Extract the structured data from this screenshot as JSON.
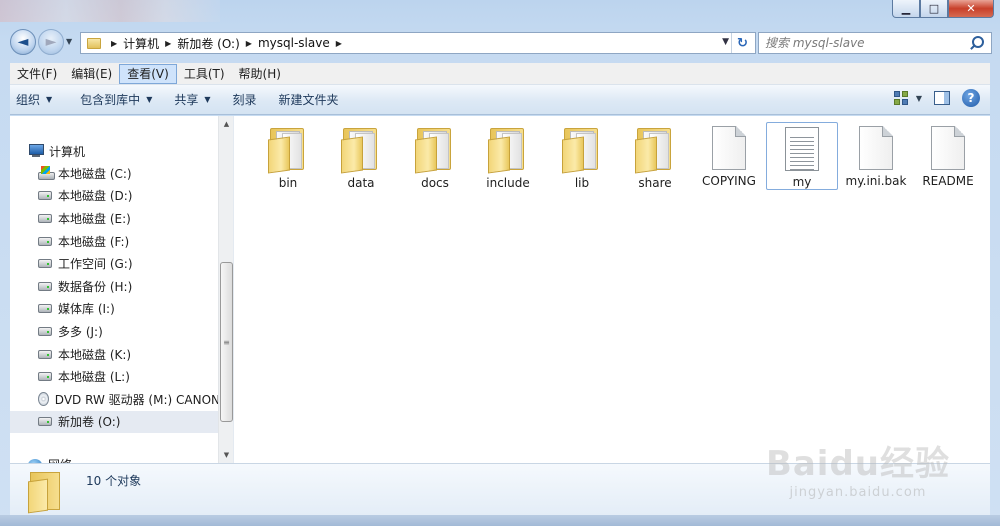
{
  "window": {
    "caption": {
      "minimize": "▁",
      "maximize": "□",
      "close": "✕"
    }
  },
  "nav": {
    "back_glyph": "◄",
    "forward_glyph": "►",
    "breadcrumbs": [
      "计算机",
      "新加卷 (O:)",
      "mysql-slave"
    ],
    "refresh_glyph": "↻",
    "search_placeholder": "搜索 mysql-slave"
  },
  "menubar": {
    "items": [
      "文件(F)",
      "编辑(E)",
      "查看(V)",
      "工具(T)",
      "帮助(H)"
    ],
    "active_index": 2
  },
  "commandbar": {
    "items": [
      {
        "label": "组织",
        "dropdown": true
      },
      {
        "label": "包含到库中",
        "dropdown": true
      },
      {
        "label": "共享",
        "dropdown": true
      },
      {
        "label": "刻录",
        "dropdown": false
      },
      {
        "label": "新建文件夹",
        "dropdown": false
      }
    ],
    "help_glyph": "?"
  },
  "navpane": {
    "root_label": "计算机",
    "drives": [
      {
        "label": "本地磁盘 (C:)",
        "icon": "system-drive-icon"
      },
      {
        "label": "本地磁盘 (D:)",
        "icon": "drive-icon"
      },
      {
        "label": "本地磁盘 (E:)",
        "icon": "drive-icon"
      },
      {
        "label": "本地磁盘 (F:)",
        "icon": "drive-icon"
      },
      {
        "label": "工作空间 (G:)",
        "icon": "drive-icon"
      },
      {
        "label": "数据备份 (H:)",
        "icon": "drive-icon"
      },
      {
        "label": "媒体库 (I:)",
        "icon": "drive-icon"
      },
      {
        "label": "多多 (J:)",
        "icon": "drive-icon"
      },
      {
        "label": "本地磁盘 (K:)",
        "icon": "drive-icon"
      },
      {
        "label": "本地磁盘 (L:)",
        "icon": "drive-icon"
      },
      {
        "label": "DVD RW 驱动器 (M:) CANON",
        "icon": "dvd-icon"
      },
      {
        "label": "新加卷 (O:)",
        "icon": "drive-icon",
        "selected": true
      }
    ],
    "network_label": "网络"
  },
  "files": [
    {
      "name": "bin",
      "type": "folder"
    },
    {
      "name": "data",
      "type": "folder"
    },
    {
      "name": "docs",
      "type": "folder"
    },
    {
      "name": "include",
      "type": "folder"
    },
    {
      "name": "lib",
      "type": "folder"
    },
    {
      "name": "share",
      "type": "folder"
    },
    {
      "name": "COPYING",
      "type": "file"
    },
    {
      "name": "my",
      "type": "text-file",
      "selected": true
    },
    {
      "name": "my.ini.bak",
      "type": "file"
    },
    {
      "name": "README",
      "type": "file"
    }
  ],
  "details": {
    "summary": "10 个对象"
  },
  "watermark": {
    "logo": "Baidu经验",
    "url": "jingyan.baidu.com"
  }
}
